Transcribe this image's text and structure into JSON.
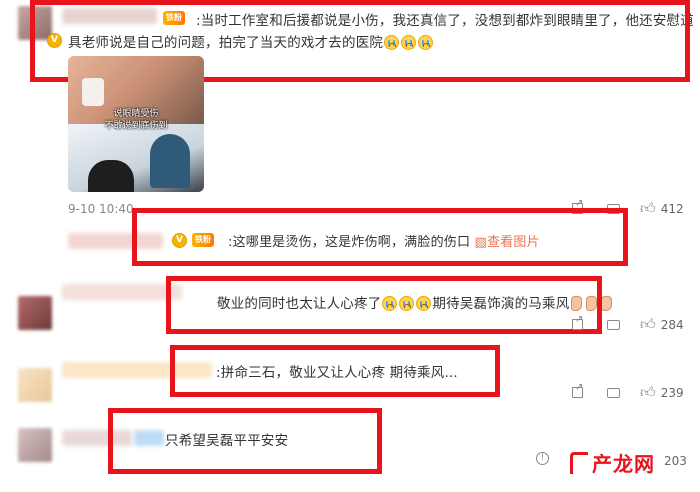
{
  "comment1": {
    "badge": "铁粉",
    "text_line1": ":当时工作室和后援都说是小伤，我还真信了，没想到都炸到眼睛里了，他还安慰道",
    "text_line2": "具老师说是自己的问题，拍完了当天的戏才去的医院",
    "image_caption_line1": "说眼睛受伤",
    "image_caption_line2": "不敢说到底伤到",
    "timestamp": "9-10 10:40",
    "like_count": "412"
  },
  "reply1": {
    "badge": "铁粉",
    "text": ":这哪里是烫伤，这是炸伤啊，满脸的伤口",
    "link": "查看图片"
  },
  "comment2": {
    "text": "敬业的同时也太让人心疼了",
    "text_tail": "期待吴磊饰演的马乘风",
    "like_count": "284"
  },
  "comment3": {
    "text": ":拼命三石，敬业又让人心疼 期待乘风...",
    "like_count": "239"
  },
  "comment4": {
    "text": "只希望吴磊平平安安",
    "like_count": "203"
  },
  "watermark": {
    "brand": "产龙网"
  },
  "colors": {
    "highlight_box": "#e8141c",
    "link": "#eb7350",
    "badge": "#ff9900"
  }
}
